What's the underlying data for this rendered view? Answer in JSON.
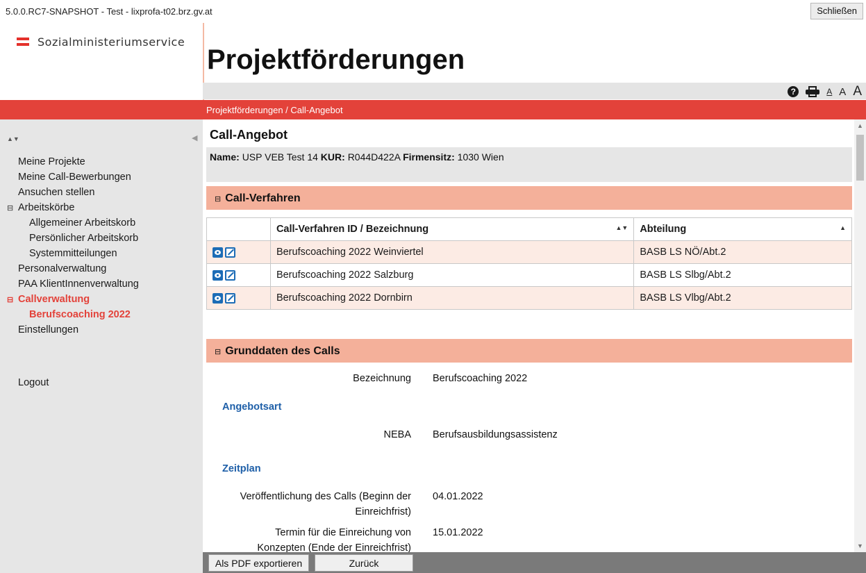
{
  "window": {
    "title": "5.0.0.RC7-SNAPSHOT - Test - lixprofa-t02.brz.gv.at",
    "close_label": "Schließen"
  },
  "brand": {
    "name": "Sozialministeriumservice"
  },
  "page": {
    "title": "Projektförderungen"
  },
  "toolbar": {
    "help_icon": "question-circle-icon",
    "print_icon": "printer-icon",
    "font_small": "A",
    "font_medium": "A",
    "font_large": "A"
  },
  "breadcrumb": "Projektförderungen / Call-Angebot",
  "sidebar": {
    "items": [
      {
        "label": "Meine Projekte"
      },
      {
        "label": "Meine Call-Bewerbungen"
      },
      {
        "label": "Ansuchen stellen"
      },
      {
        "label": "Arbeitskörbe",
        "toggle": "⊟"
      },
      {
        "label": "Allgemeiner Arbeitskorb"
      },
      {
        "label": "Persönlicher Arbeitskorb"
      },
      {
        "label": "Systemmitteilungen"
      },
      {
        "label": "Personalverwaltung"
      },
      {
        "label": "PAA KlientInnenverwaltung"
      },
      {
        "label": "Callverwaltung",
        "toggle": "⊟"
      },
      {
        "label": "Berufscoaching 2022"
      },
      {
        "label": "Einstellungen"
      }
    ],
    "logout": "Logout"
  },
  "call": {
    "heading": "Call-Angebot",
    "name_label": "Name:",
    "name_value": "USP VEB Test 14",
    "kur_label": "KUR:",
    "kur_value": "R044D422A",
    "sitz_label": "Firmensitz:",
    "sitz_value": "1030 Wien"
  },
  "verfahren": {
    "title": "Call-Verfahren",
    "toggle": "⊟",
    "col_id": "Call-Verfahren ID / Bezeichnung",
    "col_abteilung": "Abteilung",
    "rows": [
      {
        "bezeichnung": "Berufscoaching 2022 Weinviertel",
        "abteilung": "BASB LS NÖ/Abt.2"
      },
      {
        "bezeichnung": "Berufscoaching 2022 Salzburg",
        "abteilung": "BASB LS Slbg/Abt.2"
      },
      {
        "bezeichnung": "Berufscoaching 2022 Dornbirn",
        "abteilung": "BASB LS Vlbg/Abt.2"
      }
    ]
  },
  "grunddaten": {
    "title": "Grunddaten des Calls",
    "toggle": "⊟",
    "bezeichnung_label": "Bezeichnung",
    "bezeichnung_value": "Berufscoaching 2022",
    "angebotsart_heading": "Angebotsart",
    "neba_label": "NEBA",
    "neba_value": "Berufsausbildungsassistenz",
    "zeitplan_heading": "Zeitplan",
    "veroeff_label_1": "Veröffentlichung des Calls (Beginn der",
    "veroeff_label_2": "Einreichfrist)",
    "veroeff_value": "04.01.2022",
    "termin_label_1": "Termin für die Einreichung von",
    "termin_label_2": "Konzepten (Ende der Einreichfrist)",
    "termin_value": "15.01.2022"
  },
  "footer": {
    "pdf_label": "Als PDF exportieren",
    "back_label": "Zurück"
  },
  "colors": {
    "accent_red": "#e3423a",
    "panel_salmon": "#f4b09a",
    "row_tint": "#fcebe4",
    "link_blue": "#1e5fa8",
    "icon_blue": "#1c6cb6"
  }
}
